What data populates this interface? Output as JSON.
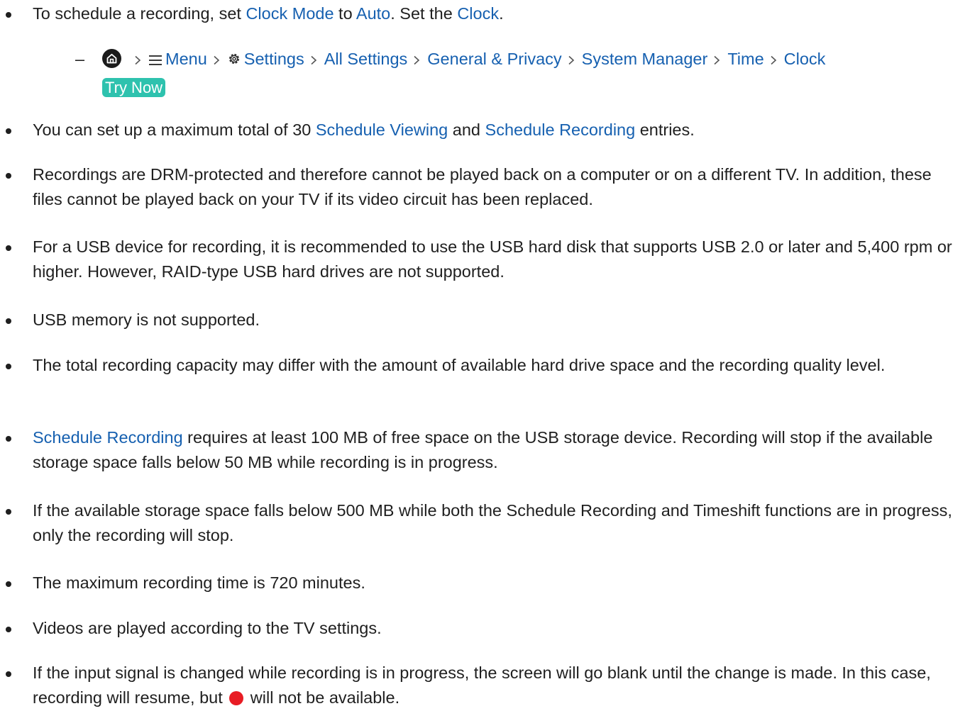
{
  "items": [
    {
      "segments": [
        "To schedule a recording, set ",
        "Clock Mode",
        " to ",
        "Auto",
        ". Set the ",
        "Clock",
        "."
      ],
      "sub": {
        "dash": "–",
        "menu": "Menu",
        "settings": "Settings",
        "all_settings": "All Settings",
        "general_privacy": "General & Privacy",
        "system_manager": "System Manager",
        "time": "Time",
        "clock": "Clock",
        "try_now": "Try Now"
      }
    },
    {
      "segments": [
        "You can set up a maximum total of 30 ",
        "Schedule Viewing",
        " and ",
        "Schedule Recording",
        " entries."
      ]
    },
    {
      "text": "Recordings are DRM-protected and therefore cannot be played back on a computer or on a different TV. In addition, these files cannot be played back on your TV if its video circuit has been replaced."
    },
    {
      "text": "For a USB device for recording, it is recommended to use the USB hard disk that supports USB 2.0 or later and 5,400 rpm or higher. However, RAID-type USB hard drives are not supported."
    },
    {
      "text": "USB memory is not supported."
    },
    {
      "text": "The total recording capacity may differ with the amount of available hard drive space and the recording quality level."
    },
    {
      "segments": [
        "Schedule Recording",
        " requires at least 100 MB of free space on the USB storage device. Recording will stop if the available storage space falls below 50 MB while recording is in progress."
      ]
    },
    {
      "text": "If the available storage space falls below 500 MB while both the Schedule Recording and Timeshift functions are in progress, only the recording will stop."
    },
    {
      "text": "The maximum recording time is 720 minutes."
    },
    {
      "text": "Videos are played according to the TV settings."
    },
    {
      "segments": [
        "If the input signal is changed while recording is in progress, the screen will go blank until the change is made. In this case, recording will resume, but ",
        " will not be available."
      ]
    }
  ],
  "colors": {
    "link": "#1660b0",
    "text": "#1f1f1f",
    "try_now_bg": "#2ec2ae",
    "record_dot": "#e81c24"
  },
  "icons": [
    "home-icon",
    "menu-icon",
    "gear-icon",
    "chevron-right-icon",
    "record-dot-icon"
  ]
}
